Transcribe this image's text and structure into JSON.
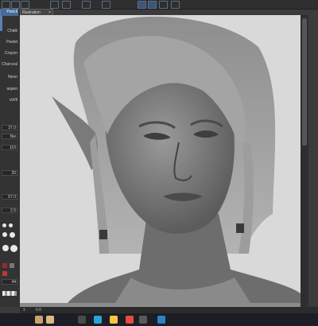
{
  "window": {
    "tab_label": "Illustration",
    "tab_close": "×"
  },
  "colors": {
    "selection": "#4a6a96",
    "canvas_bg": "#d9d9d9",
    "panel": "#333333"
  },
  "tools": [
    {
      "label": "Pencil",
      "selected": true
    },
    {
      "label": "Chalk"
    },
    {
      "label": "Pastel"
    },
    {
      "label": "Crayon"
    },
    {
      "label": "Charcoal"
    },
    {
      "label": "Neon"
    },
    {
      "label": "aspen"
    },
    {
      "label": "ctrl/ll"
    }
  ],
  "properties": {
    "brush_size": "37.0",
    "value_1": "Nw",
    "value_2": "110",
    "value_3": "20",
    "value_4": "57.0",
    "value_5": "2.5",
    "value_6": "44"
  },
  "statusbar": {
    "zoom": "1",
    "coords": "0.0"
  },
  "icons": [
    "pen-icon",
    "zoom-icon",
    "hand-icon",
    "rotate-icon",
    "eyedropper-icon"
  ]
}
